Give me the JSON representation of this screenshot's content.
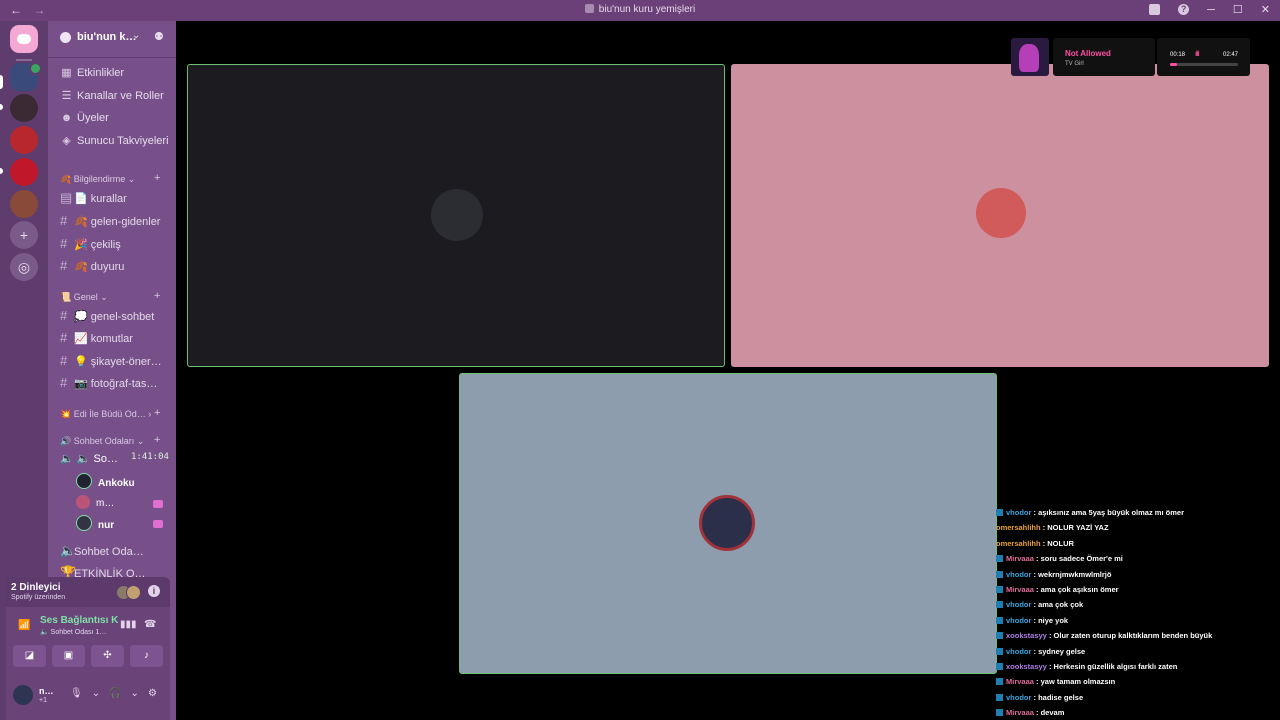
{
  "window": {
    "title": "biu'nun kuru yemişleri",
    "back": "←",
    "forward": "→"
  },
  "server": {
    "name": "biu'nun k…",
    "menu": [
      {
        "icon": "▦",
        "label": "Etkinlikler"
      },
      {
        "icon": "☰",
        "label": "Kanallar ve Roller"
      },
      {
        "icon": "☻",
        "label": "Üyeler"
      },
      {
        "icon": "◈",
        "label": "Sunucu Takviyeleri"
      }
    ]
  },
  "categories": {
    "bilgilendirme": "Bilgilendirme",
    "genel": "Genel",
    "edi": "Edi İle Büdü Od…",
    "sohbet": "Sohbet Odaları"
  },
  "channels": {
    "kurallar": "📄 kurallar",
    "gelen": "🍂 gelen-gidenler",
    "cekilis": "🎉 çekiliş",
    "duyuru": "🍂 duyuru",
    "genel_sohbet": "💭 genel-sohbet",
    "komutlar": "📈 komutlar",
    "sikayet": "💡 şikayet-öner…",
    "fotograf": "📷 fotoğraf-tas…",
    "voice_active": "So…",
    "voice_timer": "1:41:04",
    "voice_other": "Sohbet Oda…",
    "voice_etk": "ETKİNLİK O…"
  },
  "voice_members": [
    {
      "name": "Ankoku",
      "color": "#223"
    },
    {
      "name": "m…",
      "color": "#b57"
    },
    {
      "name": "nur",
      "color": "#334"
    }
  ],
  "panel": {
    "listeners": "2 Dinleyici",
    "listeners_sub": "Spotify üzerinden",
    "info": "i",
    "connection": "Ses Bağlantısı K",
    "connection_sub": "Sohbet Odası 1…",
    "user_name": "n…",
    "user_status": "+1"
  },
  "music": {
    "song": "Not Allowed",
    "artist": "TV Girl",
    "current": "00:18",
    "total": "02:47",
    "progress": 0.11
  },
  "chat": [
    {
      "user": "vhodor",
      "color": "#3aa4e0",
      "text": ": aşıksınız ama 5yaş büyük olmaz mı ömer"
    },
    {
      "user": "omersahlihh",
      "color": "#e8a13a",
      "text": ": NOLUR YAZİ YAZ"
    },
    {
      "user": "omersahlihh",
      "color": "#e8a13a",
      "text": ": NOLUR"
    },
    {
      "user": "Mirvaaa",
      "color": "#e06c9a",
      "text": ": soru sadece Ömer'e mi"
    },
    {
      "user": "vhodor",
      "color": "#3aa4e0",
      "text": ": wekrnjmwkmwlmlrjö"
    },
    {
      "user": "Mirvaaa",
      "color": "#e06c9a",
      "text": ": ama çok aşıksın ömer"
    },
    {
      "user": "vhodor",
      "color": "#3aa4e0",
      "text": ": ama çok çok"
    },
    {
      "user": "vhodor",
      "color": "#3aa4e0",
      "text": ": niye yok"
    },
    {
      "user": "xookstasyy",
      "color": "#b07de8",
      "text": ": Olur zaten oturup kalktıklarım benden büyük"
    },
    {
      "user": "vhodor",
      "color": "#3aa4e0",
      "text": ": sydney gelse"
    },
    {
      "user": "xookstasyy",
      "color": "#b07de8",
      "text": ": Herkesin güzellik algısı farklı zaten"
    },
    {
      "user": "Mirvaaa",
      "color": "#e06c9a",
      "text": ": yaw tamam olmazsın"
    },
    {
      "user": "vhodor",
      "color": "#3aa4e0",
      "text": ": hadise gelse"
    },
    {
      "user": "Mirvaaa",
      "color": "#e06c9a",
      "text": ": devam"
    }
  ]
}
